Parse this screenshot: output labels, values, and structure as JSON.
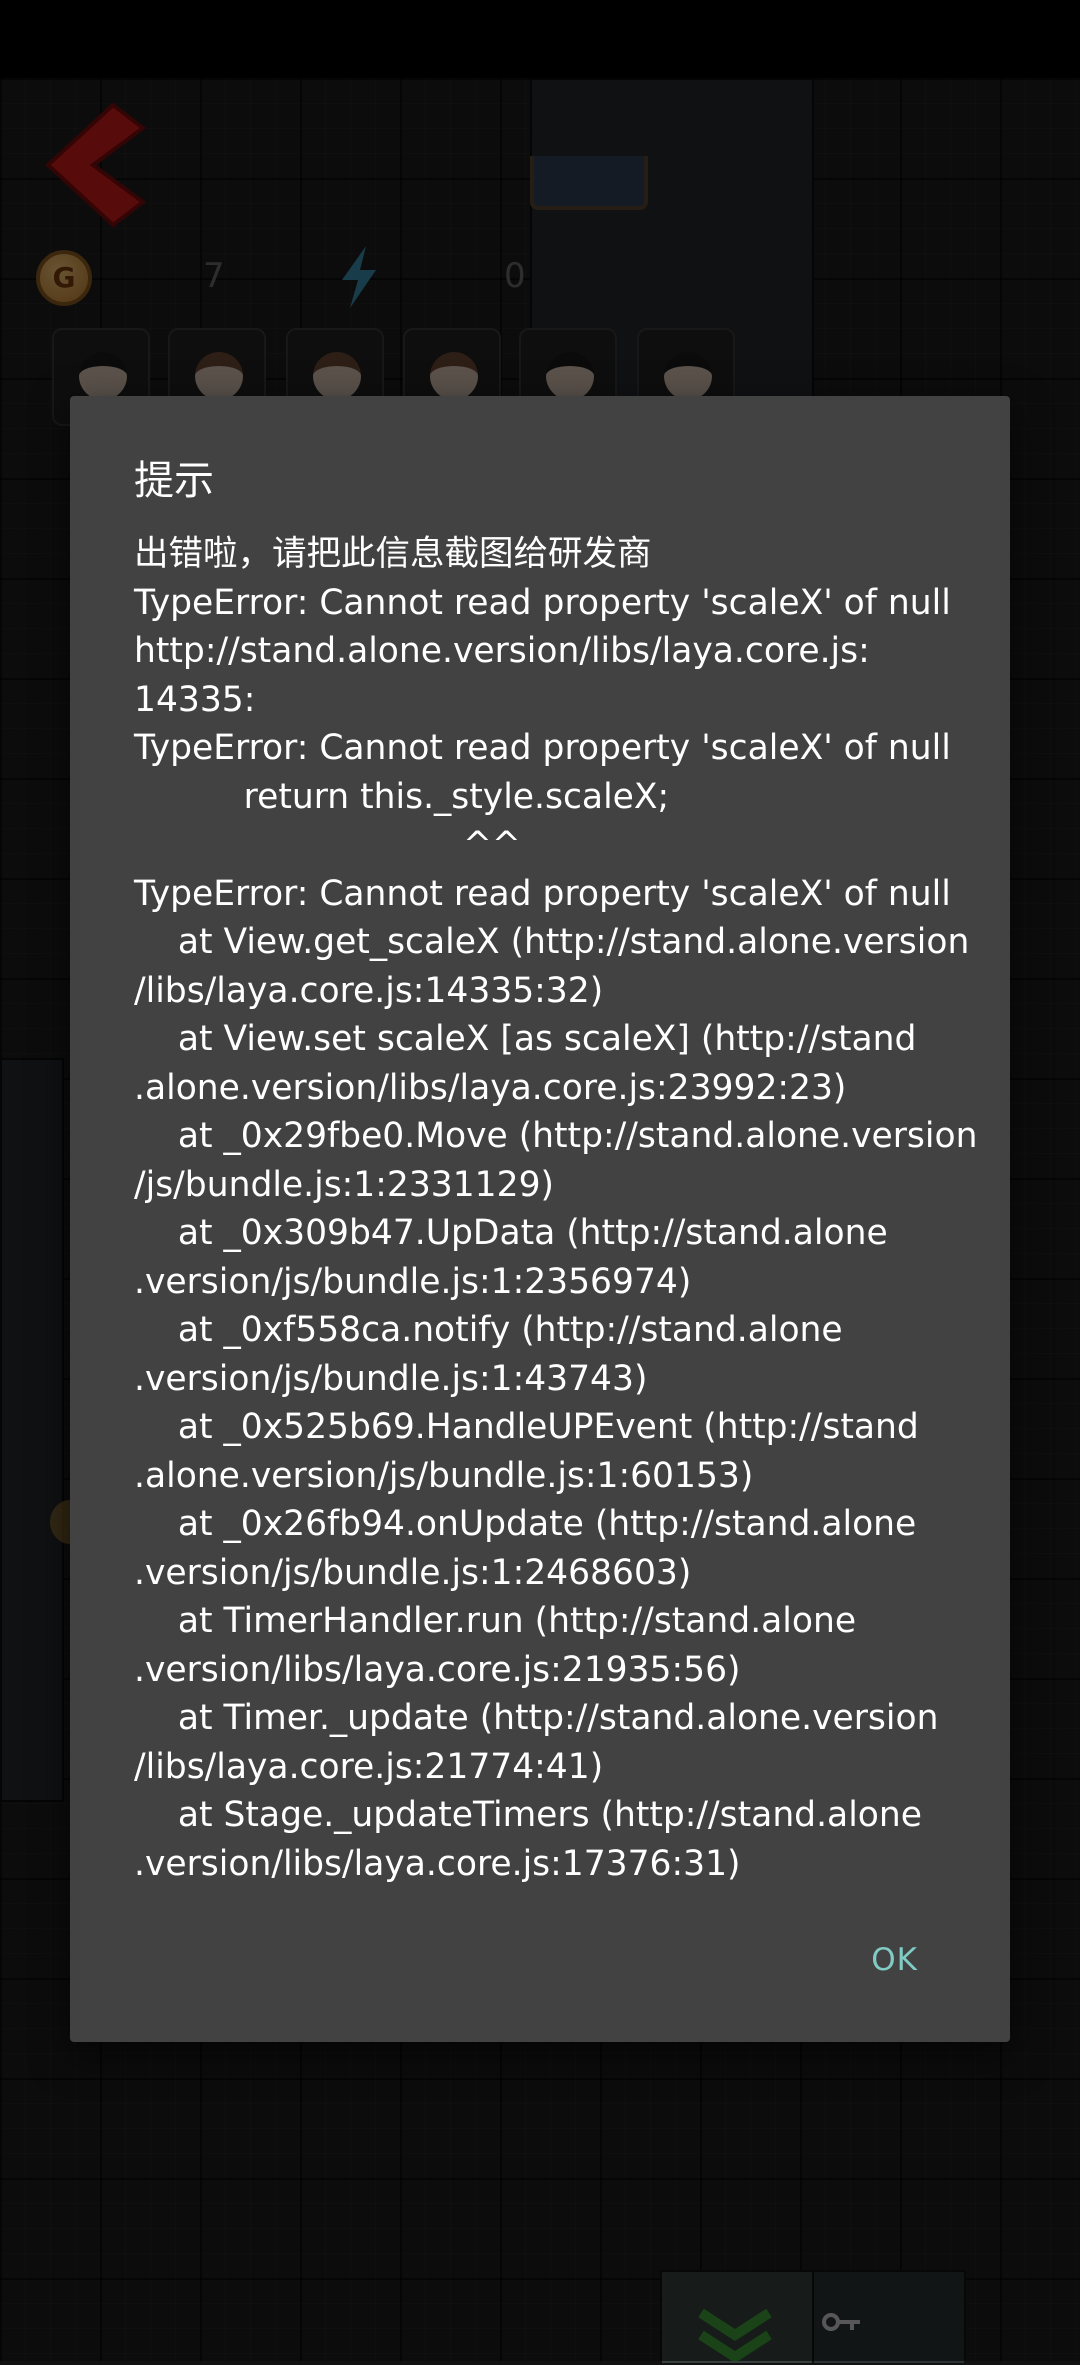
{
  "hud": {
    "coin_icon_letter": "G",
    "coin_count": "7",
    "energy_count": "0"
  },
  "dialog": {
    "title": "提示",
    "message_lines": [
      "出错啦，请把此信息截图给研发商",
      "TypeError: Cannot read property 'scaleX' of null",
      "http://stand.alone.version/libs/laya.core.js:",
      "14335:",
      "TypeError: Cannot read property 'scaleX' of null",
      "          return this._style.scaleX;",
      "                              ^^",
      "TypeError: Cannot read property 'scaleX' of null",
      "    at View.get_scaleX (http://stand.alone.version",
      "/libs/laya.core.js:14335:32)",
      "    at View.set scaleX [as scaleX] (http://stand",
      ".alone.version/libs/laya.core.js:23992:23)",
      "    at _0x29fbe0.Move (http://stand.alone.version",
      "/js/bundle.js:1:2331129)",
      "    at _0x309b47.UpData (http://stand.alone",
      ".version/js/bundle.js:1:2356974)",
      "    at _0xf558ca.notify (http://stand.alone",
      ".version/js/bundle.js:1:43743)",
      "    at _0x525b69.HandleUPEvent (http://stand",
      ".alone.version/js/bundle.js:1:60153)",
      "    at _0x26fb94.onUpdate (http://stand.alone",
      ".version/js/bundle.js:1:2468603)",
      "    at TimerHandler.run (http://stand.alone",
      ".version/libs/laya.core.js:21935:56)",
      "    at Timer._update (http://stand.alone.version",
      "/libs/laya.core.js:21774:41)",
      "    at Stage._updateTimers (http://stand.alone",
      ".version/libs/laya.core.js:17376:31)"
    ],
    "ok_label": "OK"
  },
  "colors": {
    "dialog_bg": "#424242",
    "ok_text": "#80cbc4",
    "back_arrow": "#d21b1b"
  }
}
